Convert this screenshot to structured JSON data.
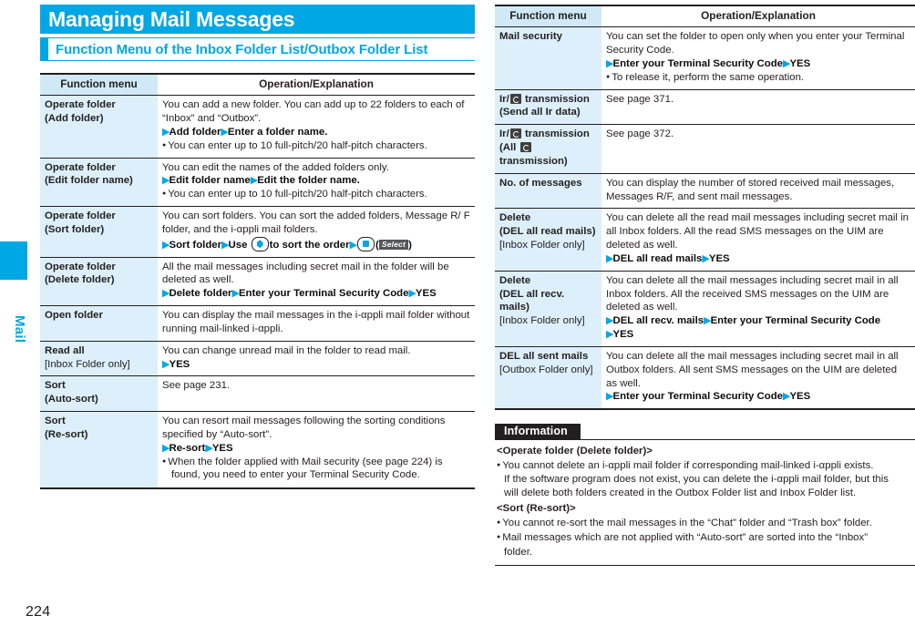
{
  "page": {
    "number": "224",
    "side_tab_label": "Mail",
    "title": "Managing Mail Messages",
    "section_heading": "Function Menu of the Inbox Folder List/Outbox Folder List",
    "accent_color": "#00a7e5",
    "menu_cell_color": "#ddeffa",
    "header_cell_color": "#cfeaf6"
  },
  "table_headers": {
    "function_menu": "Function menu",
    "operation_explanation": "Operation/Explanation"
  },
  "left_table": {
    "rows": [
      {
        "menu": "Operate folder",
        "menu_sub": "(Add folder)",
        "note": "",
        "body_line_1": "You can add a new folder. You can add up to 22 folders to each",
        "body_line_2": "of “Inbox” and “Outbox”.",
        "step_1": "Add folder",
        "step_2": "Enter a folder name.",
        "bullet_1": "You can enter up to 10 full-pitch/20 half-pitch characters."
      },
      {
        "menu": "Operate folder",
        "menu_sub": "(Edit folder name)",
        "note": "",
        "body_line_1": "You can edit the names of the added folders only.",
        "body_line_2": "",
        "step_1": "Edit folder name",
        "step_2": "Edit the folder name.",
        "bullet_1": "You can enter up to 10 full-pitch/20 half-pitch characters."
      },
      {
        "menu": "Operate folder",
        "menu_sub": "(Sort folder)",
        "note": "",
        "body_line_1": "You can sort folders. You can sort the added folders, Message R/",
        "body_line_2": "F folder, and the i-αppli mail folders.",
        "step_1": "Sort folder",
        "step_2": "Use",
        "step_3": "to sort the order",
        "key_select_label": "Select"
      },
      {
        "menu": "Operate folder",
        "menu_sub": "(Delete folder)",
        "note": "",
        "body_line_1": "All the mail messages including secret mail in the folder will be",
        "body_line_2": "deleted as well.",
        "step_1": "Delete folder",
        "step_2": "Enter your Terminal Security Code",
        "step_3": "YES"
      },
      {
        "menu": "Open folder",
        "menu_sub": "",
        "note": "",
        "body_line_1": "You can display the mail messages in the i-αppli mail folder",
        "body_line_2": "without running mail-linked i-αppli."
      },
      {
        "menu": "Read all",
        "menu_sub": "",
        "note": "[Inbox Folder only]",
        "body_line_1": "You can change unread mail in the folder to read mail.",
        "step_1": "YES"
      },
      {
        "menu": "Sort",
        "menu_sub": "(Auto-sort)",
        "note": "",
        "body_line_1": "See page 231."
      },
      {
        "menu": "Sort",
        "menu_sub": "(Re-sort)",
        "note": "",
        "body_line_1": "You can resort mail messages following the sorting conditions",
        "body_line_2": "specified by “Auto-sort”.",
        "step_1": "Re-sort",
        "step_2": "YES",
        "bullet_1": "When the folder applied with Mail security (see page 224) is",
        "bullet_1_cont": "found, you need to enter your Terminal Security Code."
      }
    ]
  },
  "right_table": {
    "rows": [
      {
        "menu": "Mail security",
        "menu_sub": "",
        "note": "",
        "body_line_1": "You can set the folder to open only when you enter your Terminal",
        "body_line_2": "Security Code.",
        "step_1": "Enter your Terminal Security Code",
        "step_2": "YES",
        "bullet_1": "To release it, perform the same operation."
      },
      {
        "menu_prefix": "Ir/",
        "menu_icon": "ic-card-icon",
        "menu_suffix": "transmission",
        "menu_sub": "(Send all Ir data)",
        "note": "",
        "body_line_1": "See page 371."
      },
      {
        "menu_prefix": "Ir/",
        "menu_icon": "ic-card-icon",
        "menu_suffix": "transmission",
        "menu_sub_prefix": "(All",
        "menu_sub_icon": "ic-card-icon",
        "menu_sub_suffix": "transmission)",
        "note": "",
        "body_line_1": "See page 372."
      },
      {
        "menu": "No. of messages",
        "menu_sub": "",
        "note": "",
        "body_line_1": "You can display the number of stored received mail messages,",
        "body_line_2": "Messages R/F, and sent mail messages."
      },
      {
        "menu": "Delete",
        "menu_sub": "(DEL all read mails)",
        "note": "[Inbox Folder only]",
        "body_line_1": "You can delete all the read mail messages including secret mail",
        "body_line_2": "in all Inbox folders. All the read SMS messages on the UIM are",
        "body_line_3": "deleted as well.",
        "step_1": "DEL all read mails",
        "step_2": "YES"
      },
      {
        "menu": "Delete",
        "menu_sub": "(DEL all recv. mails)",
        "note": "[Inbox Folder only]",
        "body_line_1": "You can delete all the mail messages including secret mail in all",
        "body_line_2": "Inbox folders. All the received SMS messages on the UIM are",
        "body_line_3": "deleted as well.",
        "step_1": "DEL all recv. mails",
        "step_2": "Enter your Terminal Security Code",
        "step_3": "YES"
      },
      {
        "menu": "DEL all sent mails",
        "menu_sub": "",
        "note": "[Outbox Folder only]",
        "body_line_1": "You can delete all the mail messages including secret mail in all",
        "body_line_2": "Outbox folders. All sent SMS messages on the UIM are deleted",
        "body_line_3": "as well.",
        "step_1": "Enter your Terminal Security Code",
        "step_2": "YES"
      }
    ]
  },
  "information": {
    "header": "Information",
    "sub_1": "<Operate folder (Delete folder)>",
    "bullet_1": "You cannot delete an i-αppli mail folder if corresponding mail-linked i-αppli exists.",
    "bullet_1_cont_1": "If the software program does not exist, you can delete the i-αppli mail folder, but this",
    "bullet_1_cont_2": "will delete both folders created in the Outbox Folder list and Inbox Folder list.",
    "sub_2": "<Sort (Re-sort)>",
    "bullet_2": "You cannot re-sort the mail messages in the “Chat” folder and “Trash box” folder.",
    "bullet_3": "Mail messages which are not applied with “Auto-sort” are sorted into the “Inbox”",
    "bullet_3_cont": "folder."
  }
}
